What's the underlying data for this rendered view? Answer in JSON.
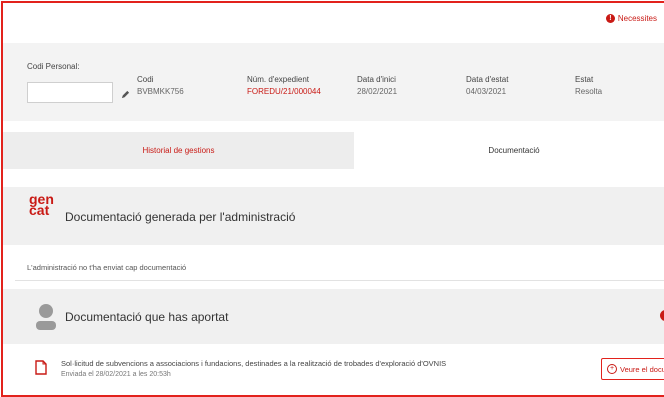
{
  "alert": {
    "icon": "exclamation-icon",
    "label": "Necessites"
  },
  "personal": {
    "codi_label": "Codi Personal:",
    "codi_value": "",
    "edit_icon": "pencil-icon"
  },
  "fields": [
    {
      "label": "Codi",
      "value": "BVBMKK756"
    },
    {
      "label": "Núm. d'expedient",
      "value": "FOREDU/21/000044"
    },
    {
      "label": "Data d'inici",
      "value": "28/02/2021"
    },
    {
      "label": "Data d'estat",
      "value": "04/03/2021"
    },
    {
      "label": "Estat",
      "value": "Resolta"
    }
  ],
  "tabs": [
    {
      "label": "Historial de gestions"
    },
    {
      "label": "Documentació"
    }
  ],
  "admin_section": {
    "logo_line1": "gen",
    "logo_line2": "cat",
    "title": "Documentació generada per l'administració",
    "empty": "L'administració no t'ha enviat cap documentació"
  },
  "user_section": {
    "avatar_icon": "user-avatar-icon",
    "title": "Documentació que has aportat"
  },
  "document": {
    "icon": "document-icon",
    "title": "Sol·licitud de subvencions a associacions i fundacions, destinades a la realització de trobades d'exploració d'OVNIS",
    "subtitle": "Enviada el 28/02/2021 a les 20:53h",
    "button_label": "Veure el document"
  },
  "colors": {
    "accent": "#c91a15",
    "border": "#e2221c",
    "panel": "#f0f0f0"
  }
}
